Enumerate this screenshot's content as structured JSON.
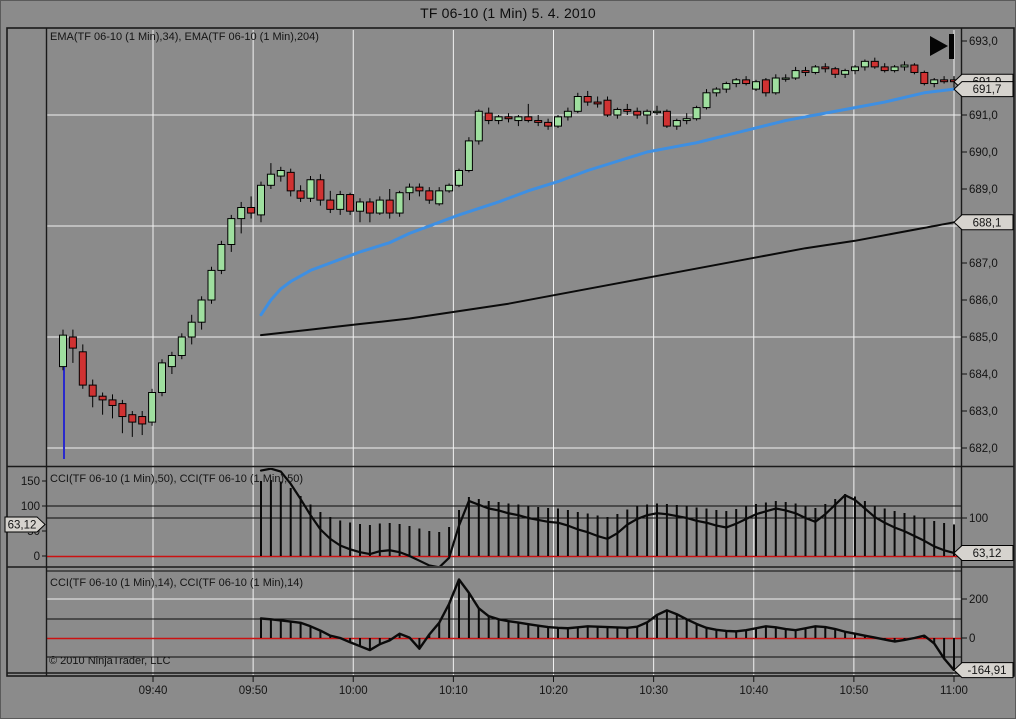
{
  "window": {
    "title": "TF 06-10 (1 Min)  5. 4. 2010"
  },
  "colors": {
    "background": "#8b8b8b",
    "grid": "#f2f2f2",
    "candle_up": "#9fdf9f",
    "candle_down": "#d03232",
    "candle_outline": "#000000",
    "ema_fast": "#3e8fe2",
    "ema_slow": "#0a0a0a",
    "zero_line": "#cc1111",
    "level_line": "#0a0a0a",
    "tag_bg": "#d6d3ce",
    "tag_border": "#000000",
    "text": "#141414",
    "session_marker": "#2a2acc",
    "frame": "#1a1a1a"
  },
  "panels": {
    "price": {
      "indicator_label": "EMA(TF 06-10 (1 Min),34), EMA(TF 06-10 (1 Min),204)",
      "right_axis_labels": [
        {
          "text": "693,0",
          "value": 693.0
        },
        {
          "text": "691,0",
          "value": 691.0
        },
        {
          "text": "690,0",
          "value": 690.0
        },
        {
          "text": "689,0",
          "value": 689.0
        },
        {
          "text": "687,0",
          "value": 687.0
        },
        {
          "text": "686,0",
          "value": 686.0
        },
        {
          "text": "685,0",
          "value": 685.0
        },
        {
          "text": "684,0",
          "value": 684.0
        },
        {
          "text": "683,0",
          "value": 683.0
        },
        {
          "text": "682,0",
          "value": 682.0
        }
      ],
      "price_tags": [
        {
          "text": "691,9",
          "value": 691.9,
          "role": "last-price"
        },
        {
          "text": "691,7",
          "value": 691.7,
          "role": "ema34-value"
        },
        {
          "text": "688,1",
          "value": 688.1,
          "role": "ema204-value"
        }
      ]
    },
    "cci50": {
      "indicator_label": "CCI(TF 06-10 (1 Min),50), CCI(TF 06-10 (1 Min),50)",
      "left_axis_labels": [
        {
          "text": "150",
          "value": 150
        },
        {
          "text": "100",
          "value": 100
        },
        {
          "text": "50",
          "value": 50
        },
        {
          "text": "0",
          "value": 0
        }
      ],
      "right_axis_labels": [
        {
          "text": "100",
          "value": 100
        }
      ],
      "left_tag": {
        "text": "63,12",
        "value": 63.12
      },
      "right_tag": {
        "text": "63,12",
        "value": 63.12
      }
    },
    "cci14": {
      "indicator_label": "CCI(TF 06-10 (1 Min),14), CCI(TF 06-10 (1 Min),14)",
      "right_axis_labels": [
        {
          "text": "200",
          "value": 200
        },
        {
          "text": "0",
          "value": 0
        }
      ],
      "right_tag": {
        "text": "-164,91",
        "value": -164.91
      }
    },
    "copyright": "© 2010 NinjaTrader, LLC"
  },
  "time_axis": {
    "labels": [
      "09:40",
      "09:50",
      "10:00",
      "10:10",
      "10:20",
      "10:30",
      "10:40",
      "10:50",
      "11:00"
    ]
  },
  "chart_data": {
    "type": "candlestick",
    "series_name": "TF 06-10 (1 Min)",
    "bar_interval_minutes": 1,
    "price_axis_range": [
      682.0,
      693.0
    ],
    "price_gridline_values": [
      682,
      685,
      688,
      691
    ],
    "candles_ohlc": [
      [
        684.2,
        685.2,
        684.1,
        685.05
      ],
      [
        685.0,
        685.2,
        684.3,
        684.7
      ],
      [
        684.6,
        684.8,
        683.6,
        683.7
      ],
      [
        683.7,
        683.85,
        683.1,
        683.4
      ],
      [
        683.4,
        683.5,
        682.9,
        683.3
      ],
      [
        683.3,
        683.45,
        682.8,
        683.15
      ],
      [
        683.2,
        683.3,
        682.4,
        682.85
      ],
      [
        682.9,
        683.0,
        682.3,
        682.7
      ],
      [
        682.85,
        683.0,
        682.35,
        682.65
      ],
      [
        682.7,
        683.6,
        682.6,
        683.5
      ],
      [
        683.5,
        684.4,
        683.4,
        684.3
      ],
      [
        684.2,
        684.6,
        684.0,
        684.5
      ],
      [
        684.5,
        685.1,
        684.4,
        685.0
      ],
      [
        685.0,
        685.6,
        684.8,
        685.4
      ],
      [
        685.4,
        686.1,
        685.2,
        686.0
      ],
      [
        686.0,
        686.9,
        685.9,
        686.8
      ],
      [
        686.8,
        687.6,
        686.7,
        687.5
      ],
      [
        687.5,
        688.3,
        687.3,
        688.2
      ],
      [
        688.2,
        688.65,
        687.8,
        688.5
      ],
      [
        688.5,
        688.8,
        688.2,
        688.35
      ],
      [
        688.3,
        689.2,
        688.1,
        689.1
      ],
      [
        689.1,
        689.7,
        689.0,
        689.4
      ],
      [
        689.35,
        689.6,
        689.2,
        689.5
      ],
      [
        689.45,
        689.55,
        688.8,
        688.95
      ],
      [
        688.95,
        689.1,
        688.65,
        688.75
      ],
      [
        688.75,
        689.35,
        688.65,
        689.25
      ],
      [
        689.25,
        689.4,
        688.55,
        688.7
      ],
      [
        688.7,
        688.95,
        688.35,
        688.45
      ],
      [
        688.45,
        688.95,
        688.3,
        688.85
      ],
      [
        688.85,
        688.9,
        688.3,
        688.4
      ],
      [
        688.4,
        688.75,
        688.1,
        688.65
      ],
      [
        688.65,
        688.75,
        688.1,
        688.35
      ],
      [
        688.35,
        688.8,
        688.3,
        688.7
      ],
      [
        688.7,
        689.0,
        688.2,
        688.35
      ],
      [
        688.35,
        688.95,
        688.25,
        688.9
      ],
      [
        688.9,
        689.15,
        688.7,
        689.05
      ],
      [
        689.05,
        689.15,
        688.8,
        688.95
      ],
      [
        688.95,
        689.05,
        688.6,
        688.7
      ],
      [
        688.6,
        689.05,
        688.55,
        688.95
      ],
      [
        688.95,
        689.15,
        688.9,
        689.1
      ],
      [
        689.1,
        689.55,
        689.05,
        689.5
      ],
      [
        689.5,
        690.4,
        689.45,
        690.3
      ],
      [
        690.3,
        691.15,
        690.2,
        691.1
      ],
      [
        691.05,
        691.2,
        690.75,
        690.85
      ],
      [
        690.85,
        691.0,
        690.75,
        690.95
      ],
      [
        690.95,
        691.05,
        690.8,
        690.9
      ],
      [
        690.85,
        691.0,
        690.7,
        690.95
      ],
      [
        690.95,
        691.3,
        690.8,
        690.85
      ],
      [
        690.85,
        691.0,
        690.7,
        690.8
      ],
      [
        690.8,
        690.9,
        690.6,
        690.7
      ],
      [
        690.7,
        691.0,
        690.65,
        690.95
      ],
      [
        690.95,
        691.2,
        690.85,
        691.1
      ],
      [
        691.1,
        691.6,
        691.05,
        691.5
      ],
      [
        691.5,
        691.65,
        691.25,
        691.35
      ],
      [
        691.35,
        691.5,
        691.2,
        691.3
      ],
      [
        691.4,
        691.5,
        690.95,
        691.0
      ],
      [
        691.0,
        691.2,
        690.9,
        691.15
      ],
      [
        691.15,
        691.3,
        691.0,
        691.1
      ],
      [
        691.1,
        691.2,
        690.9,
        691.0
      ],
      [
        691.0,
        691.15,
        690.75,
        691.1
      ],
      [
        691.1,
        691.25,
        691.0,
        691.1
      ],
      [
        691.1,
        691.15,
        690.65,
        690.7
      ],
      [
        690.7,
        690.9,
        690.6,
        690.85
      ],
      [
        690.85,
        691.05,
        690.75,
        690.9
      ],
      [
        690.9,
        691.25,
        690.85,
        691.2
      ],
      [
        691.2,
        691.7,
        691.15,
        691.6
      ],
      [
        691.6,
        691.75,
        691.5,
        691.7
      ],
      [
        691.7,
        691.9,
        691.6,
        691.85
      ],
      [
        691.85,
        692.0,
        691.75,
        691.95
      ],
      [
        691.95,
        692.05,
        691.8,
        691.85
      ],
      [
        691.7,
        691.95,
        691.65,
        691.9
      ],
      [
        691.95,
        692.0,
        691.5,
        691.6
      ],
      [
        691.6,
        692.1,
        691.55,
        692.0
      ],
      [
        692.0,
        692.1,
        691.9,
        692.0
      ],
      [
        692.0,
        692.3,
        691.95,
        692.2
      ],
      [
        692.2,
        692.3,
        692.05,
        692.15
      ],
      [
        692.15,
        692.35,
        692.1,
        692.3
      ],
      [
        692.3,
        692.4,
        692.15,
        692.25
      ],
      [
        692.25,
        692.3,
        692.0,
        692.1
      ],
      [
        692.1,
        692.25,
        692.0,
        692.2
      ],
      [
        692.2,
        692.35,
        692.1,
        692.3
      ],
      [
        692.3,
        692.5,
        692.2,
        692.45
      ],
      [
        692.45,
        692.55,
        692.25,
        692.3
      ],
      [
        692.3,
        692.4,
        692.15,
        692.2
      ],
      [
        692.2,
        692.35,
        692.15,
        692.3
      ],
      [
        692.3,
        692.45,
        692.2,
        692.35
      ],
      [
        692.35,
        692.4,
        692.1,
        692.15
      ],
      [
        692.15,
        692.2,
        691.8,
        691.85
      ],
      [
        691.85,
        692.0,
        691.75,
        691.95
      ],
      [
        691.95,
        692.05,
        691.85,
        691.9
      ],
      [
        691.95,
        692.05,
        691.7,
        691.9
      ]
    ],
    "session_marker": {
      "bar_index": 0,
      "from_price": 684.2
    },
    "ema34_points": [
      [
        20,
        685.6
      ],
      [
        21,
        686.0
      ],
      [
        22,
        686.3
      ],
      [
        23,
        686.5
      ],
      [
        25,
        686.8
      ],
      [
        27,
        687.0
      ],
      [
        30,
        687.3
      ],
      [
        33,
        687.55
      ],
      [
        35,
        687.8
      ],
      [
        38,
        688.1
      ],
      [
        40,
        688.3
      ],
      [
        44,
        688.65
      ],
      [
        47,
        688.95
      ],
      [
        50,
        689.2
      ],
      [
        53,
        689.5
      ],
      [
        56,
        689.75
      ],
      [
        59,
        690.0
      ],
      [
        62,
        690.15
      ],
      [
        64,
        690.25
      ],
      [
        67,
        690.45
      ],
      [
        70,
        690.65
      ],
      [
        73,
        690.85
      ],
      [
        76,
        691.0
      ],
      [
        80,
        691.2
      ],
      [
        83,
        691.35
      ],
      [
        87,
        691.6
      ],
      [
        90,
        691.7
      ]
    ],
    "ema204_points": [
      [
        20,
        685.05
      ],
      [
        25,
        685.2
      ],
      [
        30,
        685.35
      ],
      [
        35,
        685.5
      ],
      [
        40,
        685.7
      ],
      [
        45,
        685.9
      ],
      [
        50,
        686.15
      ],
      [
        55,
        686.4
      ],
      [
        60,
        686.65
      ],
      [
        65,
        686.9
      ],
      [
        70,
        687.15
      ],
      [
        75,
        687.4
      ],
      [
        80,
        687.6
      ],
      [
        84,
        687.8
      ],
      [
        87,
        687.95
      ],
      [
        90,
        688.1
      ]
    ],
    "cci_start_bar_index": 20,
    "cci50_values": [
      150,
      152,
      149,
      136,
      120,
      103,
      88,
      78,
      71,
      67,
      64,
      62,
      65,
      66,
      64,
      60,
      55,
      50,
      48,
      58,
      92,
      118,
      114,
      110,
      108,
      105,
      103,
      100,
      98,
      96,
      95,
      92,
      88,
      85,
      81,
      78,
      84,
      93,
      99,
      103,
      105,
      104,
      102,
      100,
      97,
      95,
      92,
      90,
      94,
      99,
      104,
      107,
      110,
      108,
      105,
      100,
      96,
      104,
      114,
      124,
      119,
      110,
      101,
      95,
      90,
      86,
      81,
      76,
      70,
      66,
      63.12
    ],
    "cci14_values": [
      100,
      96,
      90,
      84,
      78,
      60,
      38,
      12,
      0,
      -22,
      -42,
      -62,
      -32,
      -12,
      22,
      2,
      -55,
      18,
      78,
      175,
      300,
      232,
      152,
      112,
      96,
      86,
      79,
      71,
      63,
      56,
      52,
      50,
      55,
      60,
      58,
      56,
      54,
      52,
      58,
      80,
      118,
      142,
      122,
      96,
      72,
      52,
      42,
      36,
      34,
      40,
      50,
      60,
      55,
      46,
      40,
      50,
      60,
      56,
      46,
      32,
      22,
      12,
      2,
      -8,
      -18,
      -10,
      0,
      12,
      -28,
      -105,
      -164.91
    ]
  }
}
